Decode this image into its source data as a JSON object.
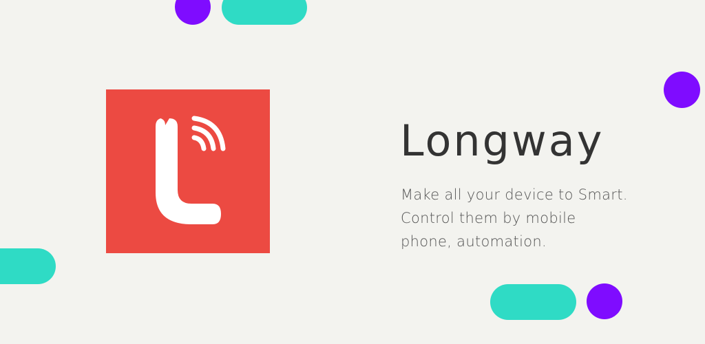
{
  "app": {
    "name": "Longway",
    "tagline_lines": [
      "Make all your device to Smart.",
      "Control them by mobile",
      "phone, automation."
    ]
  },
  "colors": {
    "background": "#f3f3ef",
    "logo_background": "#ec4a42",
    "accent_teal": "#2fdbc5",
    "accent_purple": "#7f0cff",
    "title_text": "#333333"
  },
  "icons": {
    "logo": "longway-logo-icon"
  }
}
